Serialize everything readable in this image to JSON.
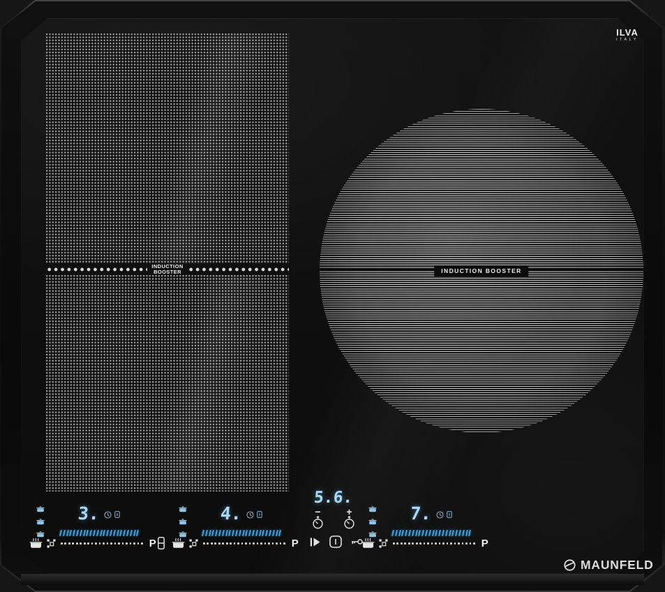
{
  "device": {
    "brand": "MAUNFELD",
    "maker": {
      "name": "ILVA",
      "country": "ITALY"
    }
  },
  "zones": {
    "flex_left": {
      "booster_label_line1": "INDUCTION",
      "booster_label_line2": "BOOSTER"
    },
    "round_right": {
      "booster_label": "INDUCTION  BOOSTER"
    }
  },
  "control_panel": {
    "flex_zone_1": {
      "level": "3.",
      "boost_label": "P",
      "tick_count": 24,
      "dot_count": 22
    },
    "flex_zone_2": {
      "level": "4.",
      "boost_label": "P",
      "tick_count": 24,
      "dot_count": 22
    },
    "right_zone": {
      "level": "7.",
      "boost_label": "P",
      "tick_count": 24,
      "dot_count": 22
    },
    "timer": {
      "value": "5.6.",
      "minus_label": "−",
      "plus_label": "+"
    }
  },
  "colors": {
    "display_blue": "#a9d9f6",
    "tick_blue": "#3ea5e4",
    "func_icon_blue": "#8fc6e8",
    "icon_white": "#e6e6e6",
    "brand_silver": "#dcdcdc",
    "glass_black": "#101010"
  },
  "icons": {
    "pot_level": "pot-level-icon",
    "pot_steam": "pot-detection-icon",
    "flex_squares": "flex-zone-icon",
    "bridge": "bridge-zones-icon",
    "clock": "timer-indicator-icon",
    "lock_ind": "lock-indicator-icon",
    "stopwatch": "stopwatch-icon",
    "pause": "pause-icon",
    "power": "power-icon",
    "key": "key-lock-icon",
    "emblem": "maunfeld-emblem-icon"
  }
}
